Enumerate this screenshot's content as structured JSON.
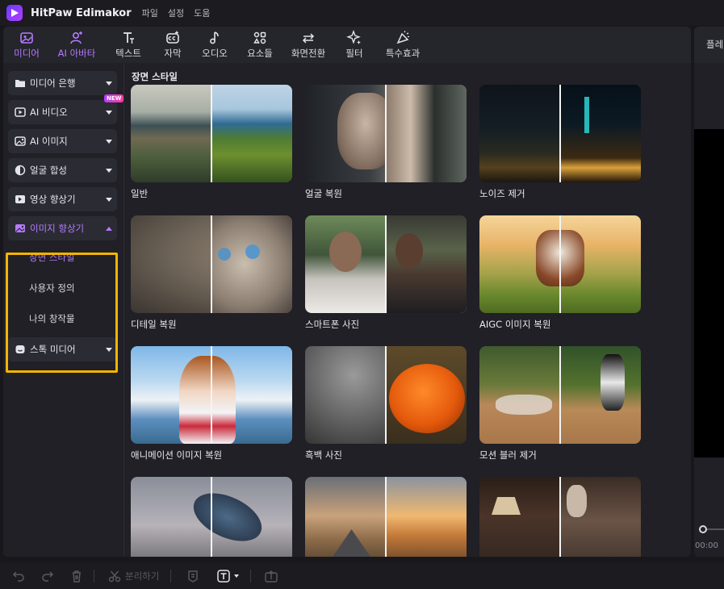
{
  "titlebar": {
    "app_name": "HitPaw Edimakor",
    "menu": [
      "파일",
      "설정",
      "도움"
    ]
  },
  "toolbar": {
    "items": [
      {
        "label": "미디어",
        "icon": "media-icon",
        "active": true
      },
      {
        "label": "AI 아바타",
        "icon": "ai-avatar-icon",
        "active": true
      },
      {
        "label": "텍스트",
        "icon": "text-icon"
      },
      {
        "label": "자막",
        "icon": "subtitle-icon"
      },
      {
        "label": "오디오",
        "icon": "audio-icon"
      },
      {
        "label": "요소들",
        "icon": "elements-icon"
      },
      {
        "label": "화면전환",
        "icon": "transition-icon"
      },
      {
        "label": "필터",
        "icon": "filter-icon"
      },
      {
        "label": "특수효과",
        "icon": "effects-icon"
      }
    ]
  },
  "sidebar": {
    "items": [
      {
        "label": "미디어 은행",
        "icon": "folder-icon"
      },
      {
        "label": "AI 비디오",
        "icon": "ai-video-icon",
        "badge": "NEW"
      },
      {
        "label": "AI 이미지",
        "icon": "ai-image-icon"
      },
      {
        "label": "얼굴 합성",
        "icon": "face-swap-icon"
      },
      {
        "label": "영상 향상기",
        "icon": "video-enhancer-icon"
      },
      {
        "label": "이미지 향상기",
        "icon": "image-enhancer-icon",
        "expanded": true
      },
      {
        "label": "스톡 미디어",
        "icon": "stock-media-icon"
      }
    ],
    "sub_items": [
      {
        "label": "장면 스타일",
        "active": true
      },
      {
        "label": "사용자 정의"
      },
      {
        "label": "나의 창작물"
      }
    ]
  },
  "content": {
    "section_title": "장면 스타일",
    "cards": [
      {
        "caption": "일반",
        "scene": "landscape"
      },
      {
        "caption": "얼굴 복원",
        "scene": "portrait"
      },
      {
        "caption": "노이즈 제거",
        "scene": "city-night"
      },
      {
        "caption": "디테일 복원",
        "scene": "cat"
      },
      {
        "caption": "스마트폰 사진",
        "scene": "selfie"
      },
      {
        "caption": "AIGC 이미지 복원",
        "scene": "cow"
      },
      {
        "caption": "애니메이션 이미지 복원",
        "scene": "anime"
      },
      {
        "caption": "흑백 사진",
        "scene": "pumpkin"
      },
      {
        "caption": "모션 블러 제거",
        "scene": "baseball"
      },
      {
        "caption": "",
        "scene": "bird"
      },
      {
        "caption": "",
        "scene": "tent"
      },
      {
        "caption": "",
        "scene": "room"
      }
    ]
  },
  "right_panel": {
    "tab_label": "플레",
    "time": "00:00"
  },
  "bottombar": {
    "split_label": "분리하기"
  },
  "colors": {
    "accent": "#b57bff",
    "highlight": "#f4b400",
    "background": "#18181c"
  }
}
